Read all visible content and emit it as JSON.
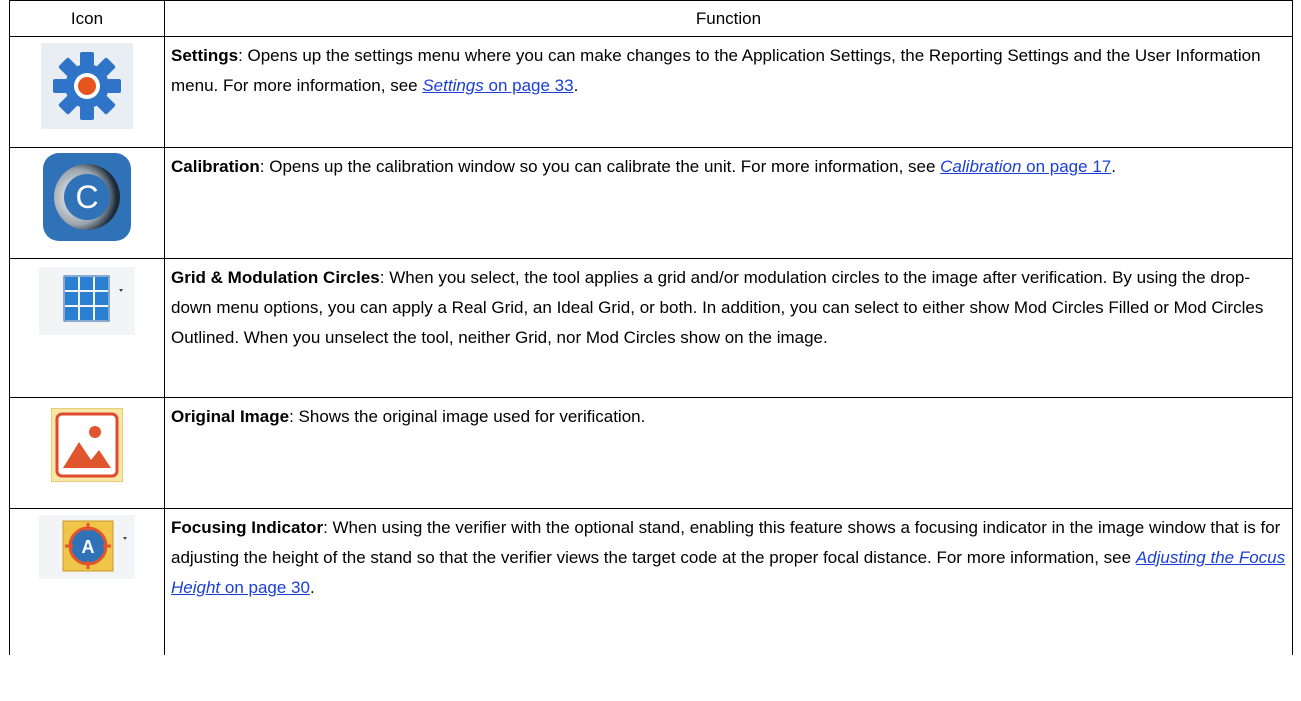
{
  "header": {
    "icon": "Icon",
    "function": "Function"
  },
  "rows": [
    {
      "icon_name": "gear-icon",
      "title": "Settings",
      "text": ": Opens up the settings menu where you can make changes to the Application Settings, the Reporting Settings and the User Information menu. For more information, see ",
      "link_italic": "Settings",
      "link_page": " on page 33",
      "after": "."
    },
    {
      "icon_name": "calibration-icon",
      "title": "Calibration",
      "text": ": Opens up the calibration window so you can calibrate the unit. For more information, see ",
      "link_italic": "Calibration",
      "link_page": " on page 17",
      "after": "."
    },
    {
      "icon_name": "grid-icon",
      "title": "Grid & Modulation Circles",
      "text": ": When you select, the tool applies a grid and/or modulation circles to the image after verification. By using the drop-down menu options, you can apply a Real Grid, an Ideal Grid, or both. In addition, you can select to either show Mod Circles Filled or Mod Circles Outlined. When you unselect the tool, neither Grid, nor Mod Circles show on the image."
    },
    {
      "icon_name": "image-icon",
      "title": "Original Image",
      "text": ": Shows the original image used for verification."
    },
    {
      "icon_name": "focus-indicator-icon",
      "title": "Focusing Indicator",
      "text": ": When using the verifier with the optional stand, enabling this feature shows a focusing indicator in the image window that is for adjusting the height of the stand so that the verifier views the target code at the proper focal distance. For more information, see ",
      "link_italic": "Adjusting the Focus Height",
      "link_page": " on page 30",
      "after": "."
    }
  ],
  "icon_letters": {
    "calibration": "C",
    "focus": "A"
  },
  "colors": {
    "link": "#1a3fd6",
    "gear": "#2f74c8",
    "gear_center": "#e8541e"
  }
}
